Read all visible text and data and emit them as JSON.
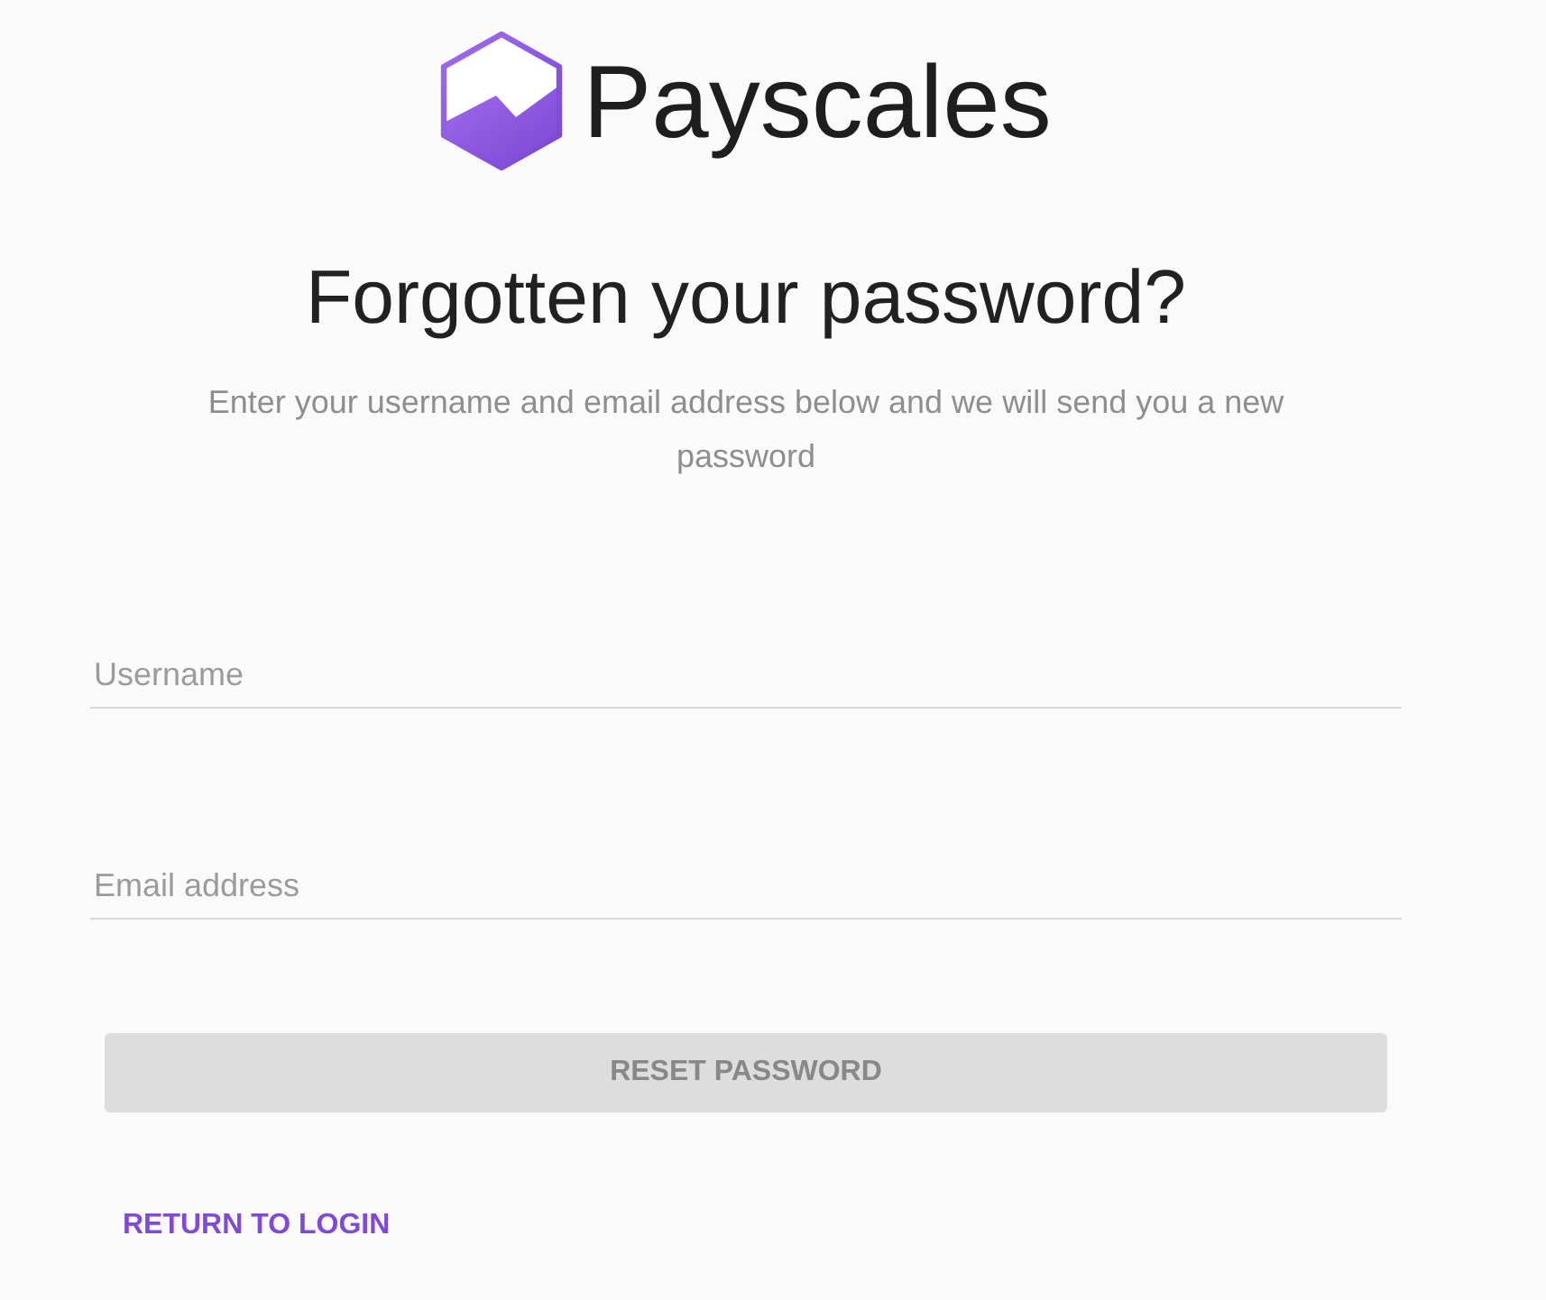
{
  "logo": {
    "name": "Payscales"
  },
  "heading": "Forgotten your password?",
  "subtitle": "Enter your username and email address below and we will send you a new password",
  "fields": [
    {
      "placeholder": "Username"
    },
    {
      "placeholder": "Email address"
    }
  ],
  "reset_button": {
    "label": "RESET PASSWORD",
    "disabled": true
  },
  "return_link": {
    "label": "RETURN TO LOGIN"
  }
}
